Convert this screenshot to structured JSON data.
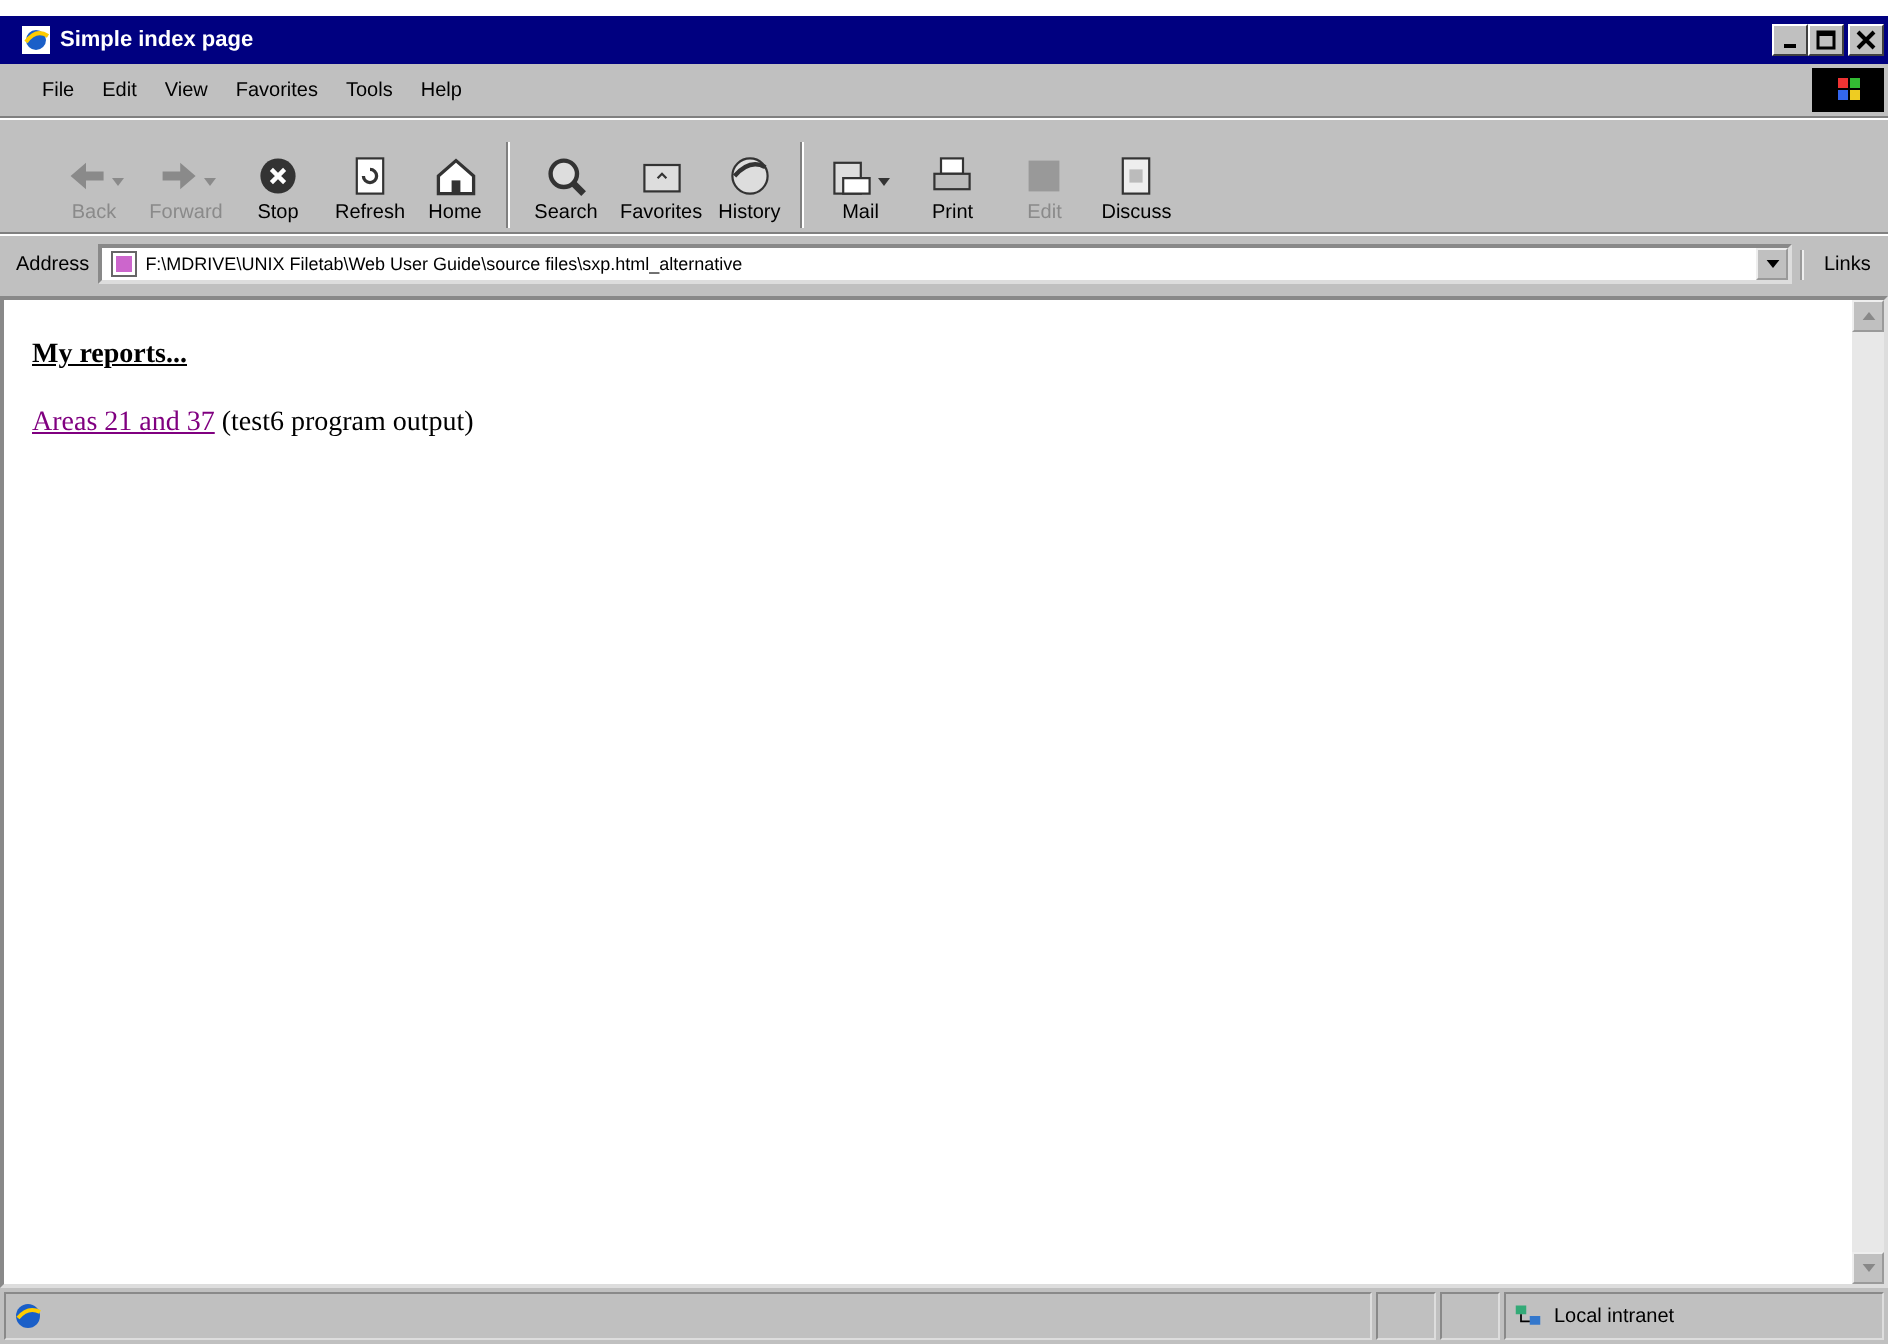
{
  "window": {
    "title": "Simple index page"
  },
  "menu": [
    "File",
    "Edit",
    "View",
    "Favorites",
    "Tools",
    "Help"
  ],
  "toolbar": [
    {
      "label": "Back",
      "disabled": true,
      "dropdown": true
    },
    {
      "label": "Forward",
      "disabled": true,
      "dropdown": true
    },
    {
      "label": "Stop",
      "disabled": false,
      "dropdown": false
    },
    {
      "label": "Refresh",
      "disabled": false,
      "dropdown": false
    },
    {
      "label": "Home",
      "disabled": false,
      "dropdown": false,
      "group_end": true
    },
    {
      "label": "Search",
      "disabled": false,
      "dropdown": false
    },
    {
      "label": "Favorites",
      "disabled": false,
      "dropdown": false
    },
    {
      "label": "History",
      "disabled": false,
      "dropdown": false,
      "group_end": true
    },
    {
      "label": "Mail",
      "disabled": false,
      "dropdown": true
    },
    {
      "label": "Print",
      "disabled": false,
      "dropdown": false
    },
    {
      "label": "Edit",
      "disabled": true,
      "dropdown": false
    },
    {
      "label": "Discuss",
      "disabled": false,
      "dropdown": false
    }
  ],
  "address": {
    "label": "Address",
    "value": "F:\\MDRIVE\\UNIX Filetab\\Web User Guide\\source files\\sxp.html_alternative",
    "links": "Links"
  },
  "page": {
    "heading": "My reports...",
    "link": "Areas 21 and 37",
    "note": "(test6 program output)",
    "link_visited": true
  },
  "status_bar": {
    "zone": "Local intranet"
  }
}
